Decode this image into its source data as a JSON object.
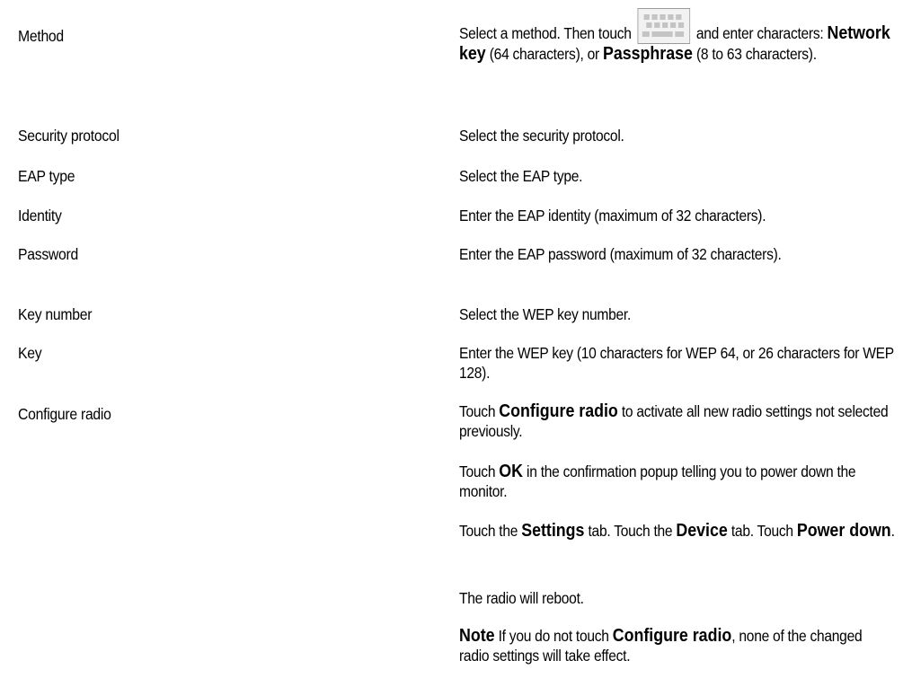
{
  "rows": [
    {
      "label": "Method",
      "desc": {
        "t1": "Select a method. Then touch",
        "t2": "and enter characters:",
        "b1": "Network key",
        "t3": "(64 characters), or",
        "b2": "Passphrase",
        "t4": "(8 to 63 characters)."
      },
      "icon": "keyboard-icon"
    },
    {
      "label": "Security protocol",
      "desc": "Select the security protocol."
    },
    {
      "label": "EAP type",
      "desc": "Select the EAP type."
    },
    {
      "label": "Identity",
      "desc": "Enter the EAP identity (maximum of 32 characters)."
    },
    {
      "label": "Password",
      "desc": "Enter the EAP password (maximum of 32 characters)."
    },
    {
      "label": "Key number",
      "desc": "Select the WEP key number."
    },
    {
      "label": "Key",
      "desc": "Enter the WEP key (10 characters for WEP 64, or 26 characters for WEP 128)."
    },
    {
      "label": "Configure radio",
      "paras": [
        {
          "t1": "Touch",
          "b1": "Configure radio",
          "t2": "to activate all new radio settings not selected previously."
        },
        {
          "t1": "Touch",
          "b1": "OK",
          "t2": "in the confirmation popup telling you to power down the monitor."
        },
        {
          "t1": "Touch the",
          "b1": "Settings",
          "t2": "tab. Touch the",
          "b2": "Device",
          "t3": "tab. Touch",
          "b3": "Power down",
          "t4": "."
        },
        {
          "t1": "The radio will reboot."
        },
        {
          "b1": "Note",
          "t1": "If you do not touch",
          "b2": "Configure radio",
          "t2": ", none of the changed radio settings will take effect."
        }
      ]
    }
  ]
}
